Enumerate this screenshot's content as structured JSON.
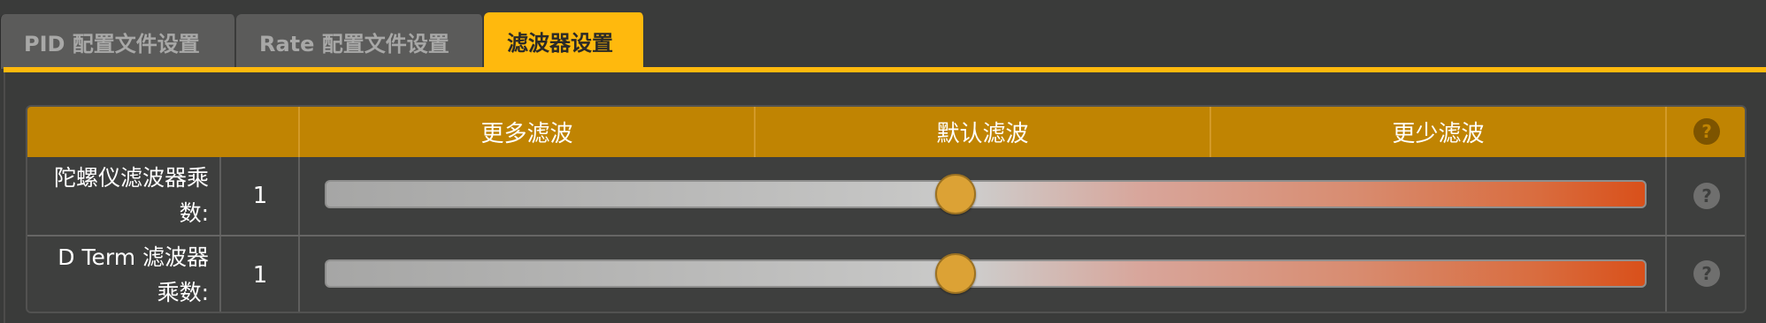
{
  "tabs": [
    {
      "label": "PID 配置文件设置",
      "active": false
    },
    {
      "label": "Rate 配置文件设置",
      "active": false
    },
    {
      "label": "滤波器设置",
      "active": true
    }
  ],
  "table": {
    "header": {
      "col_more": "更多滤波",
      "col_default": "默认滤波",
      "col_less": "更少滤波",
      "help_icon": "?"
    },
    "rows": [
      {
        "label_line1": "陀螺仪滤波器乘",
        "label_line2": "数:",
        "value": "1",
        "slider_value": 0.477,
        "help_icon": "?"
      },
      {
        "label_line1": "D Term 滤波器",
        "label_line2": "乘数:",
        "value": "1",
        "slider_value": 0.477,
        "help_icon": "?"
      }
    ]
  },
  "colors": {
    "accent": "#ffb90d",
    "header_bg": "#c08402",
    "thumb": "#dca235",
    "track_end": "#d9501a"
  }
}
